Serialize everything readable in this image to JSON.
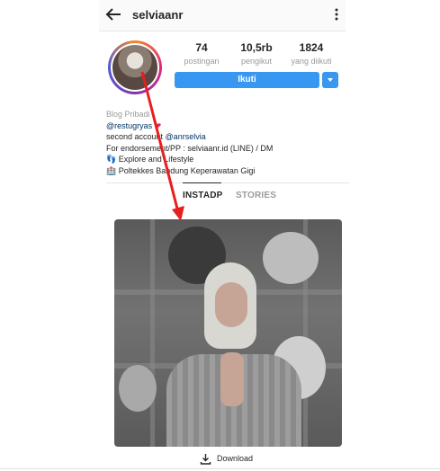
{
  "header": {
    "username": "selviaanr"
  },
  "stats": [
    {
      "value": "74",
      "label": "postingan"
    },
    {
      "value": "10,5rb",
      "label": "pengikut"
    },
    {
      "value": "1824",
      "label": "yang diikuti"
    }
  ],
  "actions": {
    "follow_label": "Ikuti"
  },
  "bio": {
    "category": "Blog Pribadi",
    "mention": "@restugryas",
    "line2_prefix": "second account ",
    "line2_mention": "@anrselvia",
    "line3": "For endorsement/PP : selviaanr.id (LINE) / DM",
    "line4": "Explore and Lifestyle",
    "line5": "Poltekkes Bandung Keperawatan Gigi"
  },
  "tabs": [
    {
      "label": "INSTADP"
    },
    {
      "label": "STORIES"
    }
  ],
  "footer": {
    "download_label": "Download"
  },
  "colors": {
    "accent": "#3897f0",
    "annotation_arrow": "#e81f1f"
  }
}
